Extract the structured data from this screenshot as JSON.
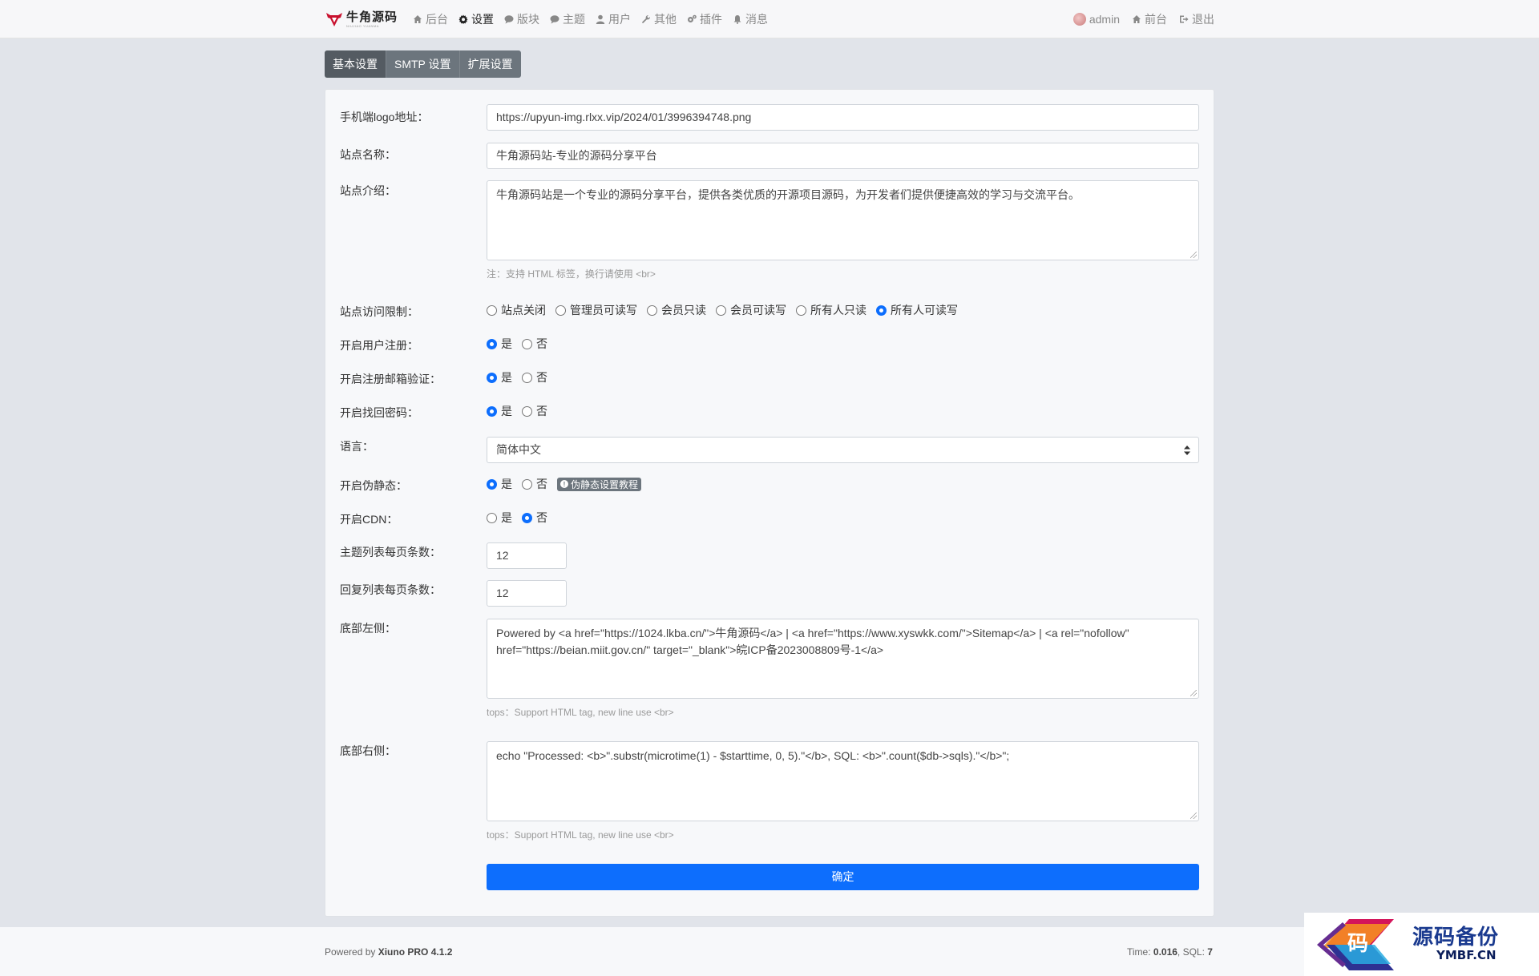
{
  "nav": {
    "brand": "牛角源码",
    "brand_sub": "NIUJIAO YUANMA",
    "items": [
      {
        "label": "后台",
        "icon": "home-icon"
      },
      {
        "label": "设置",
        "icon": "gear-icon",
        "active": true
      },
      {
        "label": "版块",
        "icon": "comment-icon"
      },
      {
        "label": "主题",
        "icon": "comments-icon"
      },
      {
        "label": "用户",
        "icon": "user-icon"
      },
      {
        "label": "其他",
        "icon": "wrench-icon"
      },
      {
        "label": "插件",
        "icon": "cogs-icon"
      },
      {
        "label": "消息",
        "icon": "bell-icon"
      }
    ],
    "right": {
      "user": "admin",
      "front": "前台",
      "logout": "退出"
    }
  },
  "tabs": [
    {
      "label": "基本设置",
      "active": true
    },
    {
      "label": "SMTP 设置"
    },
    {
      "label": "扩展设置"
    }
  ],
  "form": {
    "mobile_logo": {
      "label": "手机端logo地址：",
      "value": "https://upyun-img.rlxx.vip/2024/01/3996394748.png"
    },
    "site_name": {
      "label": "站点名称：",
      "value": "牛角源码站-专业的源码分享平台"
    },
    "site_intro": {
      "label": "站点介绍：",
      "value": "牛角源码站是一个专业的源码分享平台，提供各类优质的开源项目源码，为开发者们提供便捷高效的学习与交流平台。",
      "hint": "注：支持 HTML 标签，换行请使用 <br>"
    },
    "access": {
      "label": "站点访问限制：",
      "options": [
        "站点关闭",
        "管理员可读写",
        "会员只读",
        "会员可读写",
        "所有人只读",
        "所有人可读写"
      ],
      "selected": "所有人可读写"
    },
    "user_register": {
      "label": "开启用户注册：",
      "options": [
        "是",
        "否"
      ],
      "selected": "是"
    },
    "email_verify": {
      "label": "开启注册邮箱验证：",
      "options": [
        "是",
        "否"
      ],
      "selected": "是"
    },
    "find_password": {
      "label": "开启找回密码：",
      "options": [
        "是",
        "否"
      ],
      "selected": "是"
    },
    "language": {
      "label": "语言：",
      "value": "简体中文"
    },
    "rewrite": {
      "label": "开启伪静态：",
      "options": [
        "是",
        "否"
      ],
      "selected": "是",
      "badge": "伪静态设置教程"
    },
    "cdn": {
      "label": "开启CDN：",
      "options": [
        "是",
        "否"
      ],
      "selected": "否"
    },
    "thread_pagesize": {
      "label": "主题列表每页条数：",
      "value": "12"
    },
    "reply_pagesize": {
      "label": "回复列表每页条数：",
      "value": "12"
    },
    "footer_left": {
      "label": "底部左侧：",
      "line1": "Powered by <a href=\"https://1024.lkba.cn/\">牛角源码</a> | <a href=\"https://www.xyswkk.com/\">Sitemap</a> | <a rel=\"nofollow\"",
      "line2": "href=\"https://beian.miit.gov.cn/\" target=\"_blank\">皖ICP备2023008809号-1</a>",
      "hint": "tops：Support HTML tag, new line use <br>"
    },
    "footer_right": {
      "label": "底部右侧：",
      "value": "echo \"Processed: <b>\".substr(microtime(1) - $starttime, 0, 5).\"</b>, SQL: <b>\".count($db->sqls).\"</b>\";",
      "hint": "tops：Support HTML tag, new line use <br>"
    },
    "submit": "确定"
  },
  "footer": {
    "powered_prefix": "Powered by ",
    "powered_name": "Xiuno PRO 4.1.2",
    "time_prefix": "Time: ",
    "time_value": "0.016",
    "sql_prefix": ", SQL: ",
    "sql_value": "7"
  },
  "watermark": {
    "logo_char": "码",
    "text": "源码备份",
    "sub": "YMBF.CN"
  },
  "colors": {
    "primary": "#0d6efd",
    "tab_bg": "#6c757d",
    "tab_active": "#545b62",
    "page_bg": "#e1e4ea"
  }
}
